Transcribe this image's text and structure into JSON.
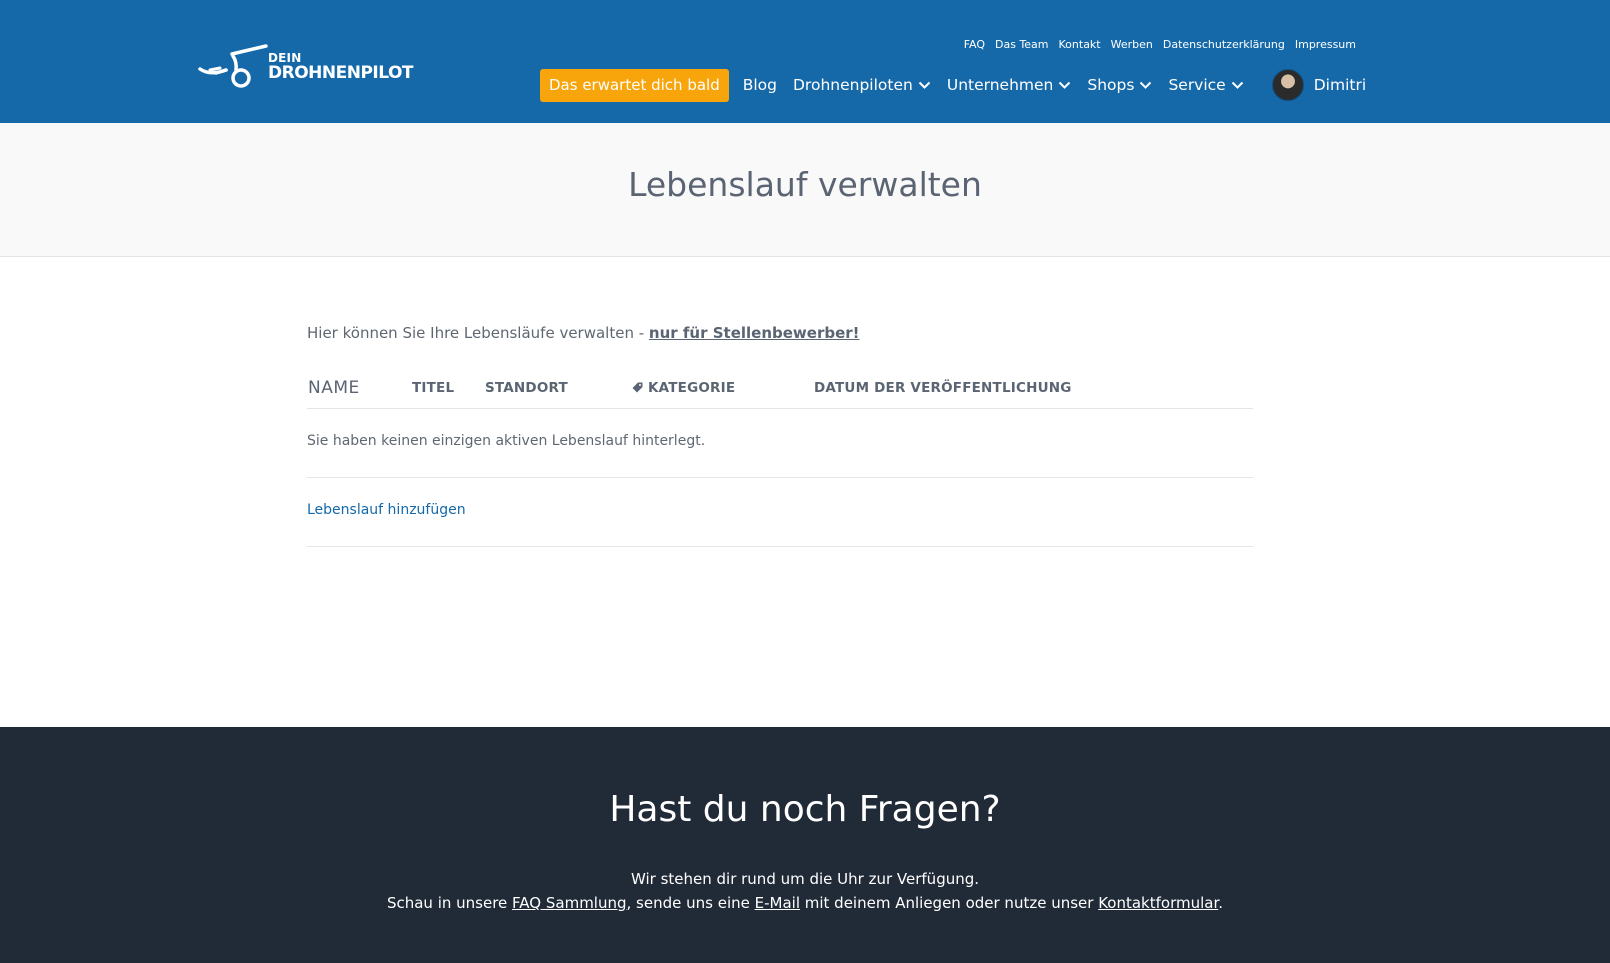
{
  "header": {
    "logo_small": "DEIN",
    "logo_big": "DROHNENPILOT",
    "top_links": [
      "FAQ",
      "Das Team",
      "Kontakt",
      "Werben",
      "Datenschutzerklärung",
      "Impressum"
    ],
    "cta_label": "Das erwartet dich bald",
    "nav": {
      "blog": "Blog",
      "drohnenpiloten": "Drohnenpiloten",
      "unternehmen": "Unternehmen",
      "shops": "Shops",
      "service": "Service"
    },
    "user_name": "Dimitri",
    "colors": {
      "bar": "#1569a9",
      "cta": "#f8a50b"
    }
  },
  "page": {
    "title": "Lebenslauf verwalten",
    "intro_text": "Hier können Sie Ihre Lebensläufe verwalten - ",
    "intro_link": "nur für Stellenbewerber!"
  },
  "table": {
    "columns": {
      "name": "NAME",
      "titel": "TITEL",
      "standort": "STANDORT",
      "kategorie": "KATEGORIE",
      "datum": "DATUM DER VERÖFFENTLICHUNG"
    },
    "empty_message": "Sie haben keinen einzigen aktiven Lebenslauf hinterlegt.",
    "add_link": "Lebenslauf hinzufügen"
  },
  "footer": {
    "title": "Hast du noch Fragen?",
    "line1": "Wir stehen dir rund um die Uhr zur Verfügung.",
    "line2_a": "Schau in unsere ",
    "faq_link": "FAQ Sammlung",
    "line2_b": ", sende uns eine ",
    "email_link": "E-Mail",
    "line2_c": " mit deinem Anliegen oder nutze unser ",
    "contact_link": "Kontaktformular",
    "line2_d": ".",
    "colors": {
      "background": "#212a37"
    }
  }
}
